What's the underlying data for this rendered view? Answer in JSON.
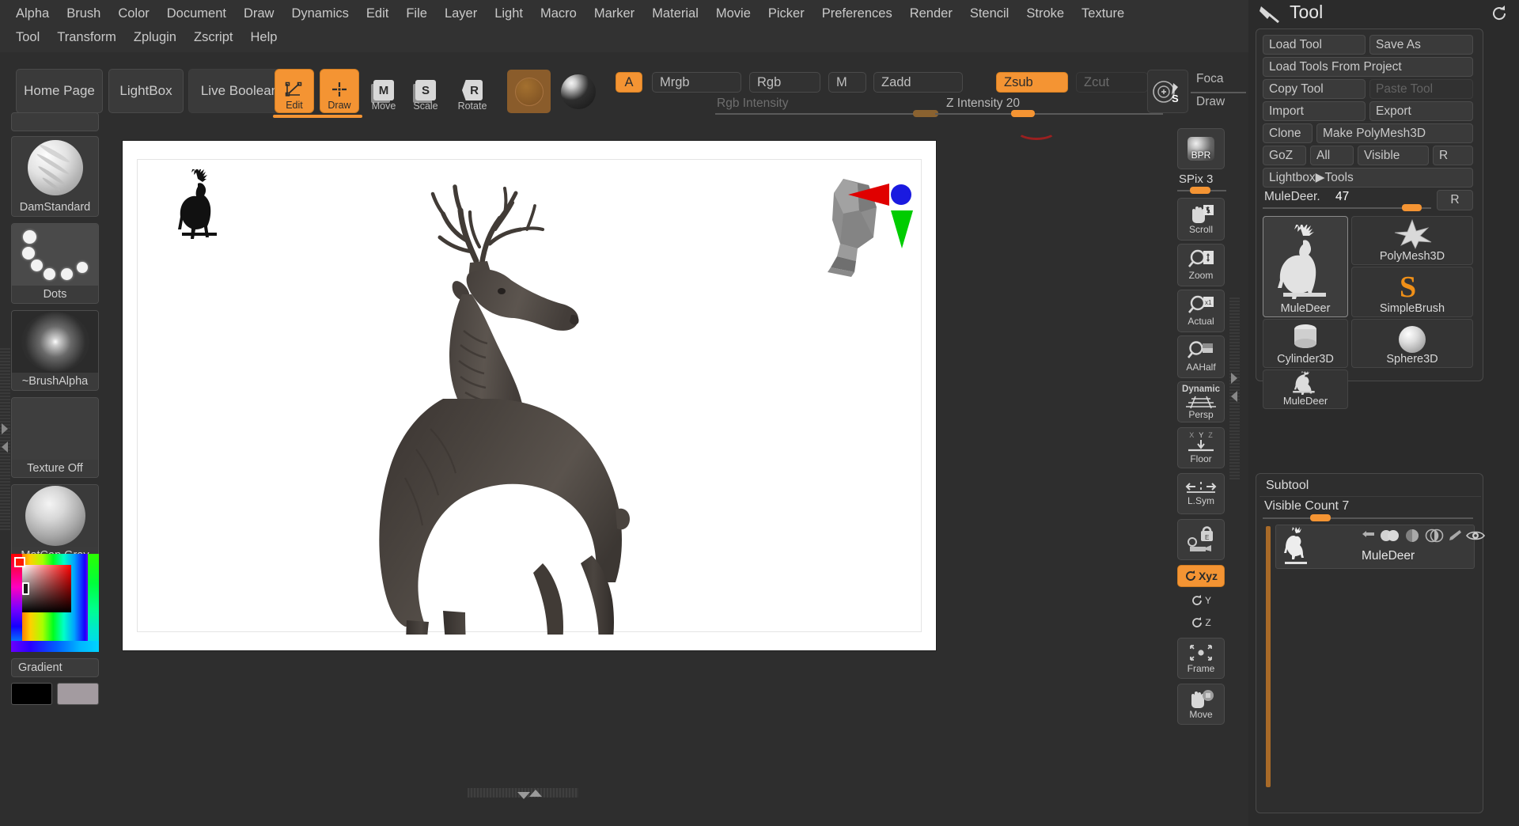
{
  "menu": {
    "row1": [
      "Alpha",
      "Brush",
      "Color",
      "Document",
      "Draw",
      "Dynamics",
      "Edit",
      "File",
      "Layer",
      "Light",
      "Macro",
      "Marker",
      "Material",
      "Movie",
      "Picker",
      "Preferences",
      "Render",
      "Stencil",
      "Stroke",
      "Texture"
    ],
    "row2": [
      "Tool",
      "Transform",
      "Zplugin",
      "Zscript",
      "Help"
    ]
  },
  "toolbar": {
    "home_page": "Home Page",
    "lightbox": "LightBox",
    "live_boolean": "Live Boolean",
    "edit": "Edit",
    "draw": "Draw",
    "move": "Move",
    "move_glyph": "M",
    "scale": "Scale",
    "scale_glyph": "S",
    "rotate": "Rotate",
    "rotate_glyph": "R",
    "alpha_toggle": "A",
    "mrgb": "Mrgb",
    "rgb": "Rgb",
    "m": "M",
    "zadd": "Zadd",
    "zsub": "Zsub",
    "zcut": "Zcut",
    "rgb_intensity_label": "Rgb Intensity",
    "rgb_intensity_value": 100,
    "z_intensity_label": "Z Intensity 20",
    "z_intensity_value": 20,
    "focal_shift_label": "Foca",
    "draw_size_label": "Draw"
  },
  "leftbar": {
    "brush": {
      "name": "DamStandard",
      "icon": "brush-sphere-icon"
    },
    "stroke": {
      "name": "Dots",
      "icon": "dots-stroke-icon"
    },
    "alpha": {
      "name": "~BrushAlpha",
      "icon": "alpha-glow-icon"
    },
    "texture": {
      "name": "Texture Off",
      "icon": "texture-off-icon"
    },
    "material": {
      "name": "MatCap Gray",
      "icon": "matcap-sphere-icon"
    },
    "gradient": "Gradient",
    "swatch_main": "#000000",
    "swatch_secondary": "#a39ba0"
  },
  "rightbar": {
    "bpr": "BPR",
    "spix_label": "SPix 3",
    "spix_value": 3,
    "scroll": "Scroll",
    "zoom": "Zoom",
    "actual": "Actual",
    "aahalf": "AAHalf",
    "dynamic": "Dynamic",
    "persp": "Persp",
    "floor": "Floor",
    "lsym": "L.Sym",
    "local_lock": "local-lock-icon",
    "xyz": "Xyz",
    "rot_y": "Y",
    "rot_z": "Z",
    "frame": "Frame",
    "move": "Move"
  },
  "tool_panel": {
    "title": "Tool",
    "reset_icon": "reset-icon",
    "hammer_icon": "tool-hammer-icon",
    "buttons": {
      "load_tool": "Load Tool",
      "save_as": "Save As",
      "load_tools_from_project": "Load Tools From Project",
      "copy_tool": "Copy Tool",
      "paste_tool": "Paste Tool",
      "import": "Import",
      "export": "Export",
      "clone": "Clone",
      "make_polymesh3d": "Make PolyMesh3D",
      "goz": "GoZ",
      "all": "All",
      "visible": "Visible",
      "r": "R",
      "lightbox_tools": "Lightbox▶Tools"
    },
    "item_slider": {
      "label": "MuleDeer.",
      "value": "47",
      "reset": "R"
    },
    "tools": [
      {
        "name": "MuleDeer",
        "icon": "deer-icon",
        "selected": true
      },
      {
        "name": "PolyMesh3D",
        "icon": "star-polymesh-icon",
        "selected": false
      },
      {
        "name": "SimpleBrush",
        "icon": "simplebrush-s-icon",
        "selected": false
      },
      {
        "name": "Cylinder3D",
        "icon": "cylinder-icon",
        "selected": false
      },
      {
        "name": "Sphere3D",
        "icon": "sphere-icon",
        "selected": false
      },
      {
        "name": "MuleDeer",
        "icon": "deer-icon",
        "selected": false
      }
    ]
  },
  "subtool_panel": {
    "title": "Subtool",
    "visible_count_label": "Visible Count 7",
    "visible_count_value": 7,
    "rows": [
      {
        "name": "MuleDeer",
        "icons": [
          "arrow-down-left-icon",
          "polypaint-icon",
          "half-circle-icon",
          "split-circle-icon",
          "brush-icon",
          "eye-icon"
        ]
      }
    ]
  },
  "canvas": {
    "model_name": "MuleDeer",
    "thumbnail_icon": "deer-silhouette-icon",
    "nav_head_icon": "nav-head-icon",
    "gizmo": {
      "x_axis_color": "#e00000",
      "y_axis_color": "#00cc00",
      "z_axis_color": "#1a1ae0"
    }
  },
  "colors": {
    "accent": "#f49433",
    "panel_bg": "#2e2e2e",
    "button_bg": "#3a3a3a",
    "text": "#c9c9c9",
    "canvas_bg": "#ffffff"
  }
}
